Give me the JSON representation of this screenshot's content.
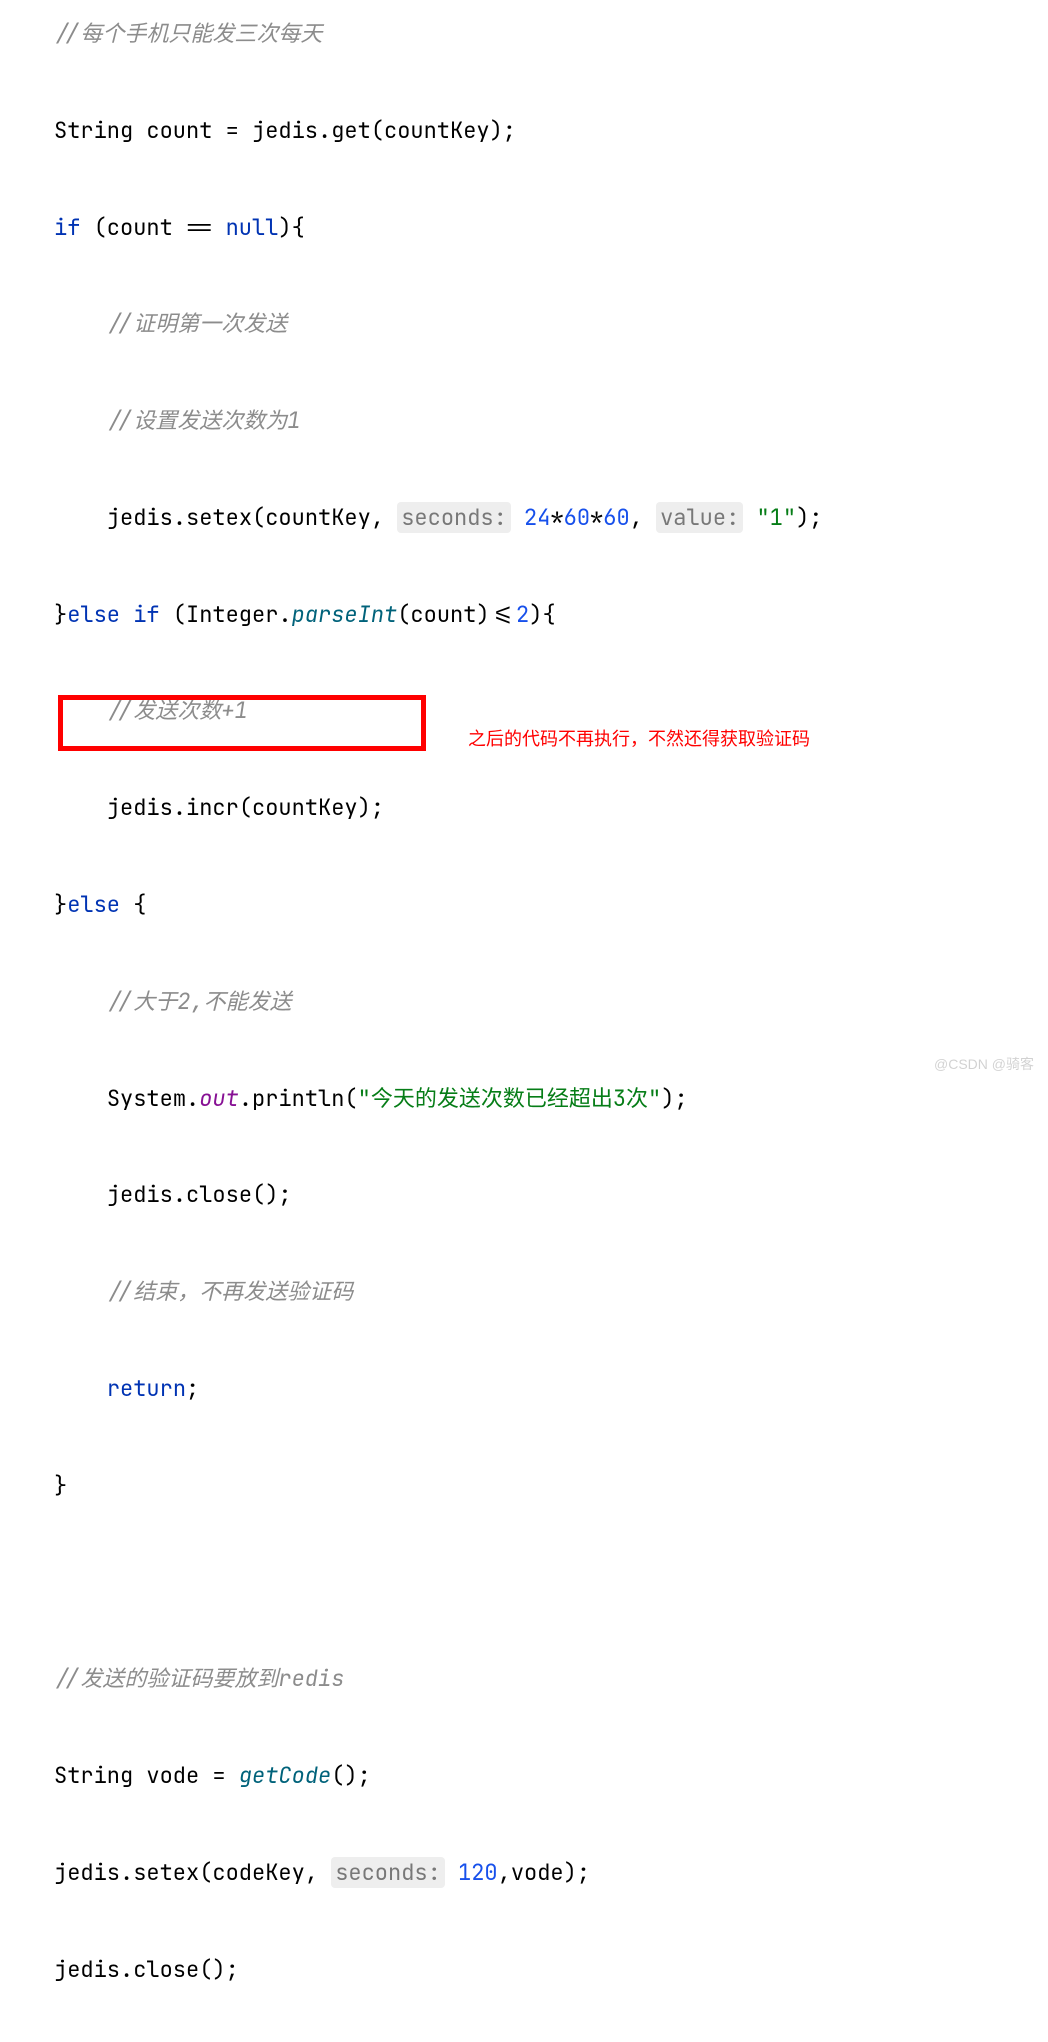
{
  "code": {
    "l1": "//每个手机只能发三次每天",
    "l2_a": "String count = jedis.get(countKey);",
    "l3_if": "if",
    "l3_cond": " (count == ",
    "l3_null": "null",
    "l3_close": "){",
    "l4": "//证明第一次发送",
    "l5": "//设置发送次数为1",
    "l6_a": "jedis.setex(countKey, ",
    "l6_hint1": "seconds:",
    "l6_n1": " 24",
    "l6_op": "*",
    "l6_n2": "60",
    "l6_n3": "60",
    "l6_sep": ", ",
    "l6_hint2": "value:",
    "l6_str": " \"1\"",
    "l6_end": ");",
    "l7_else": "}",
    "l7_elsekw": "else if",
    "l7_mid": " (Integer.",
    "l7_parse": "parseInt",
    "l7_rest": "(count)<=",
    "l7_num": "2",
    "l7_end": "){",
    "l8": "//发送次数+1",
    "l9": "jedis.incr(countKey);",
    "l10_a": "}",
    "l10_kw": "else",
    "l10_b": " {",
    "l11": "//大于2,不能发送",
    "l12_a": "System.",
    "l12_out": "out",
    "l12_b": ".println(",
    "l12_str": "\"今天的发送次数已经超出3次\"",
    "l12_end": ");",
    "l13": "jedis.close();",
    "l14": "//结束，不再发送验证码",
    "l15_kw": "return",
    "l15_end": ";",
    "l16": "}",
    "l18": "//发送的验证码要放到redis",
    "l19_a": "String vode = ",
    "l19_call": "getCode",
    "l19_end": "();",
    "l20_a": "jedis.setex(codeKey, ",
    "l20_hint": "seconds:",
    "l20_n": " 120",
    "l20_end": ",vode);",
    "l21": "jedis.close();"
  },
  "annotation": "之后的代码不再执行，不然还得获取验证码",
  "watermark": "@CSDN @骑客"
}
